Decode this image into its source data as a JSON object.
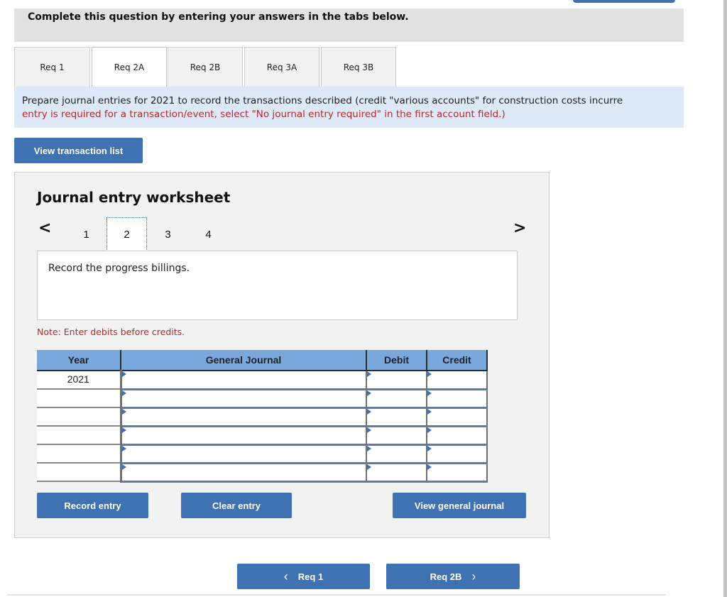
{
  "header": {
    "title": "Complete this question by entering your answers in the tabs below."
  },
  "tabs": [
    {
      "label": "Req 1",
      "active": false
    },
    {
      "label": "Req 2A",
      "active": true
    },
    {
      "label": "Req 2B",
      "active": false
    },
    {
      "label": "Req 3A",
      "active": false
    },
    {
      "label": "Req 3B",
      "active": false
    }
  ],
  "instructions": {
    "line1": "Prepare journal entries for 2021 to record the transactions described (credit \"various accounts\" for construction costs incurre",
    "line2": "entry is required for a transaction/event, select \"No journal entry required\" in the first account field.)"
  },
  "buttons": {
    "view_transaction_list": "View transaction list",
    "record_entry": "Record entry",
    "clear_entry": "Clear entry",
    "view_general_journal": "View general journal",
    "prev_req": "Req 1",
    "next_req": "Req 2B"
  },
  "worksheet": {
    "title": "Journal entry worksheet",
    "pager": {
      "prev_icon": "<",
      "next_icon": ">",
      "pages": [
        "1",
        "2",
        "3",
        "4"
      ],
      "current_page": "2"
    },
    "description": "Record the progress billings.",
    "note": "Note: Enter debits before credits."
  },
  "journal_table": {
    "columns": [
      "Year",
      "General Journal",
      "Debit",
      "Credit"
    ],
    "rows": [
      {
        "year": "2021",
        "account": "",
        "debit": "",
        "credit": ""
      },
      {
        "year": "",
        "account": "",
        "debit": "",
        "credit": ""
      },
      {
        "year": "",
        "account": "",
        "debit": "",
        "credit": ""
      },
      {
        "year": "",
        "account": "",
        "debit": "",
        "credit": ""
      },
      {
        "year": "",
        "account": "",
        "debit": "",
        "credit": ""
      },
      {
        "year": "",
        "account": "",
        "debit": "",
        "credit": ""
      }
    ]
  },
  "nav_icons": {
    "prev": "‹",
    "next": "›"
  },
  "colors": {
    "button_blue": "#3f72b3",
    "table_header_blue": "#7aa8dd",
    "instructions_bg": "#dde9f6",
    "note_red": "#b52a2a",
    "header_gray": "#e1e1e1",
    "worksheet_bg": "#f2f2f2"
  }
}
